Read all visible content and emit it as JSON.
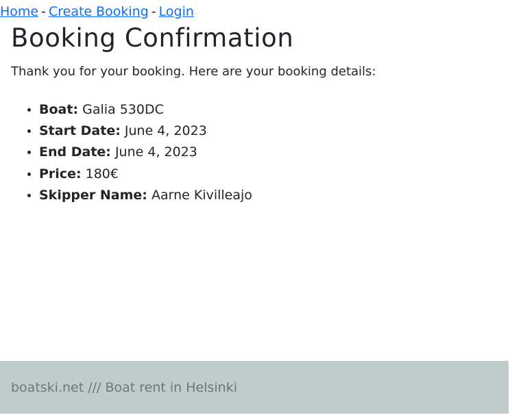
{
  "nav": {
    "links": [
      {
        "label": "Home"
      },
      {
        "label": "Create Booking"
      },
      {
        "label": "Login"
      }
    ],
    "separator": "-"
  },
  "page_title": "Booking Confirmation",
  "intro": "Thank you for your booking. Here are your booking details:",
  "details": [
    {
      "label": "Boat:",
      "value": "Galia 530DC"
    },
    {
      "label": "Start Date:",
      "value": "June 4, 2023"
    },
    {
      "label": "End Date:",
      "value": "June 4, 2023"
    },
    {
      "label": "Price:",
      "value": "180€"
    },
    {
      "label": "Skipper Name:",
      "value": "Aarne Kivilleajo"
    }
  ],
  "footer": {
    "text": "boatski.net /// Boat rent in Helsinki"
  },
  "colors": {
    "link": "#0d6efd",
    "footer_bg": "#c0cccc",
    "footer_text": "#6c757d"
  }
}
